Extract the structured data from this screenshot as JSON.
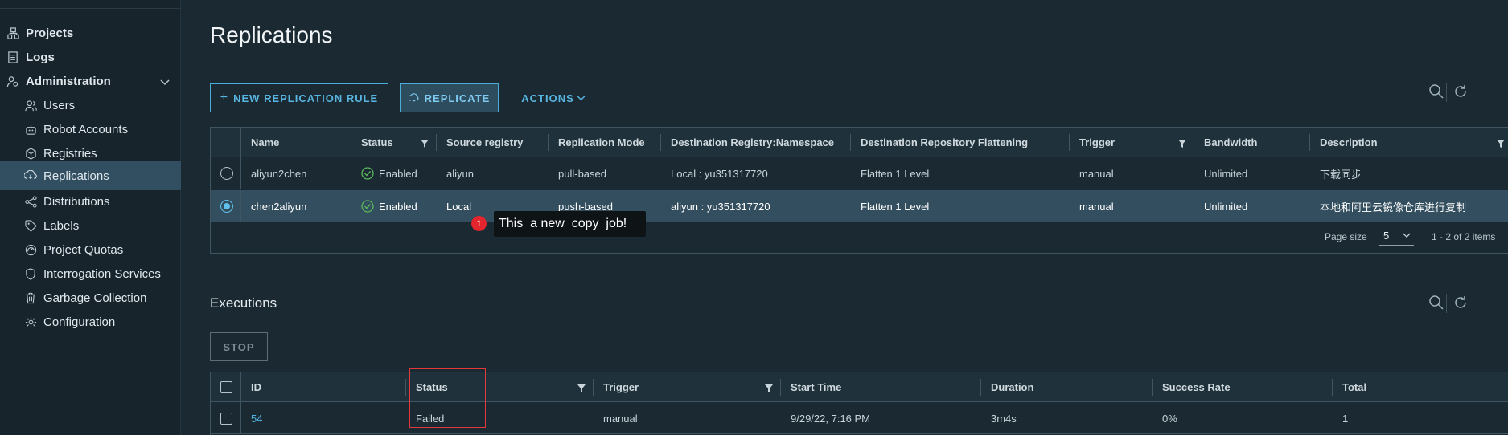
{
  "sidebar": {
    "items": [
      {
        "label": "Projects",
        "icon": "projects-icon"
      },
      {
        "label": "Logs",
        "icon": "logs-icon"
      },
      {
        "label": "Administration",
        "icon": "administration-icon"
      },
      {
        "label": "Users",
        "icon": "users-icon"
      },
      {
        "label": "Robot Accounts",
        "icon": "robot-icon"
      },
      {
        "label": "Registries",
        "icon": "registries-icon"
      },
      {
        "label": "Replications",
        "icon": "replications-icon"
      },
      {
        "label": "Distributions",
        "icon": "distributions-icon"
      },
      {
        "label": "Labels",
        "icon": "labels-icon"
      },
      {
        "label": "Project Quotas",
        "icon": "quotas-icon"
      },
      {
        "label": "Interrogation Services",
        "icon": "shield-icon"
      },
      {
        "label": "Garbage Collection",
        "icon": "trash-icon"
      },
      {
        "label": "Configuration",
        "icon": "gear-icon"
      }
    ],
    "active": "Replications"
  },
  "page": {
    "title": "Replications"
  },
  "toolbar": {
    "new_rule": "NEW REPLICATION RULE",
    "replicate": "REPLICATE",
    "actions": "ACTIONS"
  },
  "rules_table": {
    "columns": [
      "Name",
      "Status",
      "Source registry",
      "Replication Mode",
      "Destination Registry:Namespace",
      "Destination Repository Flattening",
      "Trigger",
      "Bandwidth",
      "Description"
    ],
    "rows": [
      {
        "name": "aliyun2chen",
        "status": "Enabled",
        "source": "aliyun",
        "mode": "pull-based",
        "dest": "Local : yu351317720",
        "flatten": "Flatten 1 Level",
        "trigger": "manual",
        "bandwidth": "Unlimited",
        "description": "下载同步"
      },
      {
        "name": "chen2aliyun",
        "status": "Enabled",
        "source": "Local",
        "mode": "push-based",
        "dest": "aliyun : yu351317720",
        "flatten": "Flatten 1 Level",
        "trigger": "manual",
        "bandwidth": "Unlimited",
        "description": "本地和阿里云镜像仓库进行复制"
      }
    ],
    "selected_row": 1,
    "page_size_label": "Page size",
    "page_size": "5",
    "count": "1 - 2 of 2 items"
  },
  "tooltip": {
    "badge": "1",
    "text": "This  a new  copy  job!"
  },
  "executions": {
    "title": "Executions",
    "stop": "STOP",
    "columns": [
      "ID",
      "Status",
      "Trigger",
      "Start Time",
      "Duration",
      "Success Rate",
      "Total"
    ],
    "rows": [
      {
        "id": "54",
        "status": "Failed",
        "trigger": "manual",
        "start": "9/29/22, 7:16 PM",
        "duration": "3m4s",
        "success_rate": "0%",
        "total": "1"
      }
    ]
  },
  "colors": {
    "accent": "#4aaed9",
    "success": "#5cb85c",
    "highlight": "#e23a3a"
  }
}
